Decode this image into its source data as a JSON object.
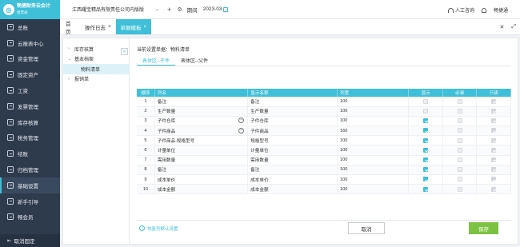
{
  "app": {
    "logo_title": "畅捷财务云会计",
    "logo_sub": "捷票通"
  },
  "sidebar": {
    "items": [
      {
        "label": "总账",
        "icon": "ledger-icon"
      },
      {
        "label": "云报表中心",
        "icon": "report-icon"
      },
      {
        "label": "资金管理",
        "icon": "money-icon"
      },
      {
        "label": "固定资产",
        "icon": "asset-icon"
      },
      {
        "label": "工资",
        "icon": "salary-icon"
      },
      {
        "label": "发票管理",
        "icon": "invoice-icon"
      },
      {
        "label": "库存核算",
        "icon": "inventory-icon"
      },
      {
        "label": "税务管理",
        "icon": "tax-icon"
      },
      {
        "label": "结账",
        "icon": "close-period-icon"
      },
      {
        "label": "归档管理",
        "icon": "archive-icon"
      },
      {
        "label": "基础设置",
        "icon": "settings-icon",
        "active": true
      },
      {
        "label": "新手引导",
        "icon": "guide-icon"
      },
      {
        "label": "畅会员",
        "icon": "member-icon"
      }
    ],
    "footer_label": "取消固定"
  },
  "topbar": {
    "company": "江西耀宝精品有限责任公司内版版",
    "period_label": "期间",
    "period_value": "2023-03",
    "support": "人工咨询",
    "username": "畅捷通"
  },
  "tabs": [
    {
      "label": "首页",
      "closable": false
    },
    {
      "label": "操作日志",
      "closable": true
    },
    {
      "label": "单据模板",
      "closable": true,
      "active": true
    }
  ],
  "tree": [
    {
      "label": "库存核算",
      "level": 1,
      "arrow": ">"
    },
    {
      "label": "基本档案",
      "level": 1,
      "arrow": "v"
    },
    {
      "label": "物料清单",
      "level": 2,
      "selected": true
    },
    {
      "label": "报销单",
      "level": 1,
      "arrow": ">"
    }
  ],
  "panel": {
    "current_setting": "当前设置单据：物料清单",
    "subtabs": [
      "表体区--子件",
      "表体区--父件"
    ]
  },
  "table": {
    "headers": [
      "顺序",
      "列名",
      "显示名称",
      "列宽",
      "显示",
      "必录",
      "只读"
    ],
    "rows": [
      {
        "idx": "1",
        "name": "备注",
        "display": "备注",
        "width": "100",
        "show": false,
        "show_dis": true,
        "req": false,
        "ro": true,
        "minus": false
      },
      {
        "idx": "2",
        "name": "生产数量",
        "display": "生产数量",
        "width": "100",
        "show": false,
        "show_dis": true,
        "req": false,
        "ro": true,
        "minus": false
      },
      {
        "idx": "3",
        "name": "子件仓库",
        "display": "子件仓库",
        "width": "100",
        "show": true,
        "show_dis": false,
        "req": false,
        "ro": true,
        "minus": true
      },
      {
        "idx": "4",
        "name": "子件商品",
        "display": "子件商品",
        "width": "160",
        "show": true,
        "show_dis": false,
        "req": false,
        "ro": true,
        "minus": true
      },
      {
        "idx": "5",
        "name": "子件商品.规格型号",
        "display": "规格型号",
        "width": "100",
        "show": true,
        "show_dis": false,
        "req": false,
        "ro": true,
        "minus": false
      },
      {
        "idx": "6",
        "name": "计量单位",
        "display": "计量单位",
        "width": "100",
        "show": true,
        "show_dis": false,
        "req": false,
        "ro": true,
        "minus": false
      },
      {
        "idx": "7",
        "name": "需用数量",
        "display": "需用数量",
        "width": "100",
        "show": true,
        "show_dis": false,
        "req": false,
        "ro": true,
        "minus": false
      },
      {
        "idx": "8",
        "name": "备注",
        "display": "备注",
        "width": "100",
        "show": true,
        "show_dis": false,
        "req": false,
        "ro": true,
        "minus": false
      },
      {
        "idx": "9",
        "name": "成本单价",
        "display": "成本单价",
        "width": "100",
        "show": true,
        "show_dis": false,
        "req": false,
        "ro": true,
        "minus": false
      },
      {
        "idx": "10",
        "name": "成本金额",
        "display": "成本金额",
        "width": "100",
        "show": true,
        "show_dis": false,
        "req": false,
        "ro": true,
        "minus": false
      }
    ]
  },
  "footer": {
    "restore_link": "恢复列默认设置",
    "cancel_label": "取消",
    "save_label": "保存"
  },
  "colors": {
    "accent": "#3fbfd8",
    "sidebar_bg": "#2e3b4c",
    "save_green": "#7dc242"
  }
}
